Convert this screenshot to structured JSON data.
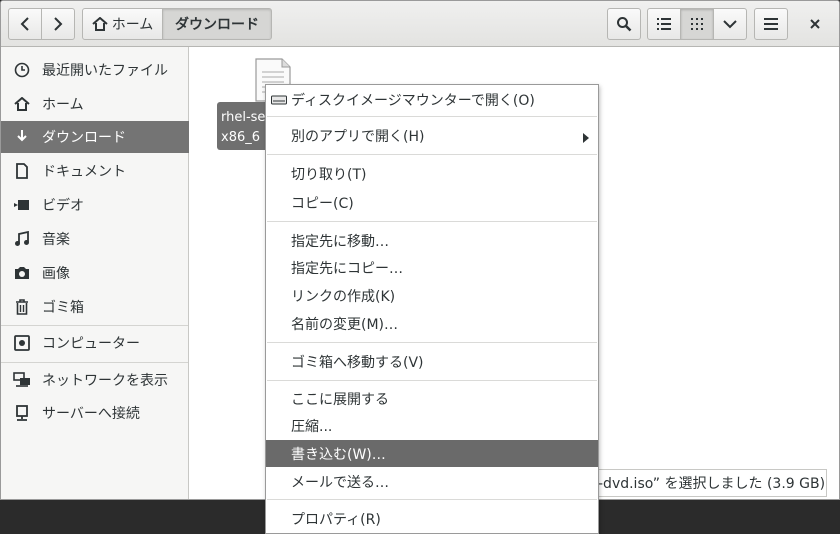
{
  "toolbar": {
    "home_label": "ホーム",
    "current_label": "ダウンロード"
  },
  "sidebar": {
    "items": [
      {
        "label": "最近開いたファイル",
        "icon": "clock-icon"
      },
      {
        "label": "ホーム",
        "icon": "home-icon"
      },
      {
        "label": "ダウンロード",
        "icon": "download-icon"
      },
      {
        "label": "ドキュメント",
        "icon": "document-icon"
      },
      {
        "label": "ビデオ",
        "icon": "video-icon"
      },
      {
        "label": "音楽",
        "icon": "music-icon"
      },
      {
        "label": "画像",
        "icon": "camera-icon"
      },
      {
        "label": "ゴミ箱",
        "icon": "trash-icon"
      },
      {
        "label": "コンピューター",
        "icon": "computer-icon"
      },
      {
        "label": "ネットワークを表示",
        "icon": "network-icon"
      },
      {
        "label": "サーバーへ接続",
        "icon": "server-icon"
      }
    ]
  },
  "content": {
    "file_label_line1": "rhel-se",
    "file_label_line2": "x86_6",
    "status": "-dvd.iso” を選択しました (3.9 GB)"
  },
  "menu": {
    "items": [
      {
        "label": "ディスクイメージマウンターで開く(O)"
      },
      {
        "label": "別のアプリで開く(H)"
      },
      {
        "label": "切り取り(T)"
      },
      {
        "label": "コピー(C)"
      },
      {
        "label": "指定先に移動…"
      },
      {
        "label": "指定先にコピー…"
      },
      {
        "label": "リンクの作成(K)"
      },
      {
        "label": "名前の変更(M)…"
      },
      {
        "label": "ゴミ箱へ移動する(V)"
      },
      {
        "label": "ここに展開する"
      },
      {
        "label": "圧縮..."
      },
      {
        "label": "書き込む(W)…"
      },
      {
        "label": "メールで送る…"
      },
      {
        "label": "プロパティ(R)"
      }
    ]
  }
}
